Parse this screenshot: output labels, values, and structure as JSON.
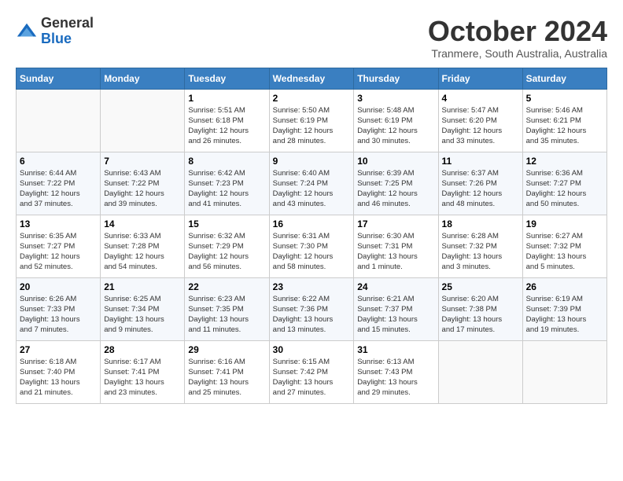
{
  "header": {
    "logo_general": "General",
    "logo_blue": "Blue",
    "month_title": "October 2024",
    "location": "Tranmere, South Australia, Australia"
  },
  "calendar": {
    "days_of_week": [
      "Sunday",
      "Monday",
      "Tuesday",
      "Wednesday",
      "Thursday",
      "Friday",
      "Saturday"
    ],
    "weeks": [
      [
        {
          "day": "",
          "info": ""
        },
        {
          "day": "",
          "info": ""
        },
        {
          "day": "1",
          "info": "Sunrise: 5:51 AM\nSunset: 6:18 PM\nDaylight: 12 hours\nand 26 minutes."
        },
        {
          "day": "2",
          "info": "Sunrise: 5:50 AM\nSunset: 6:19 PM\nDaylight: 12 hours\nand 28 minutes."
        },
        {
          "day": "3",
          "info": "Sunrise: 5:48 AM\nSunset: 6:19 PM\nDaylight: 12 hours\nand 30 minutes."
        },
        {
          "day": "4",
          "info": "Sunrise: 5:47 AM\nSunset: 6:20 PM\nDaylight: 12 hours\nand 33 minutes."
        },
        {
          "day": "5",
          "info": "Sunrise: 5:46 AM\nSunset: 6:21 PM\nDaylight: 12 hours\nand 35 minutes."
        }
      ],
      [
        {
          "day": "6",
          "info": "Sunrise: 6:44 AM\nSunset: 7:22 PM\nDaylight: 12 hours\nand 37 minutes."
        },
        {
          "day": "7",
          "info": "Sunrise: 6:43 AM\nSunset: 7:22 PM\nDaylight: 12 hours\nand 39 minutes."
        },
        {
          "day": "8",
          "info": "Sunrise: 6:42 AM\nSunset: 7:23 PM\nDaylight: 12 hours\nand 41 minutes."
        },
        {
          "day": "9",
          "info": "Sunrise: 6:40 AM\nSunset: 7:24 PM\nDaylight: 12 hours\nand 43 minutes."
        },
        {
          "day": "10",
          "info": "Sunrise: 6:39 AM\nSunset: 7:25 PM\nDaylight: 12 hours\nand 46 minutes."
        },
        {
          "day": "11",
          "info": "Sunrise: 6:37 AM\nSunset: 7:26 PM\nDaylight: 12 hours\nand 48 minutes."
        },
        {
          "day": "12",
          "info": "Sunrise: 6:36 AM\nSunset: 7:27 PM\nDaylight: 12 hours\nand 50 minutes."
        }
      ],
      [
        {
          "day": "13",
          "info": "Sunrise: 6:35 AM\nSunset: 7:27 PM\nDaylight: 12 hours\nand 52 minutes."
        },
        {
          "day": "14",
          "info": "Sunrise: 6:33 AM\nSunset: 7:28 PM\nDaylight: 12 hours\nand 54 minutes."
        },
        {
          "day": "15",
          "info": "Sunrise: 6:32 AM\nSunset: 7:29 PM\nDaylight: 12 hours\nand 56 minutes."
        },
        {
          "day": "16",
          "info": "Sunrise: 6:31 AM\nSunset: 7:30 PM\nDaylight: 12 hours\nand 58 minutes."
        },
        {
          "day": "17",
          "info": "Sunrise: 6:30 AM\nSunset: 7:31 PM\nDaylight: 13 hours\nand 1 minute."
        },
        {
          "day": "18",
          "info": "Sunrise: 6:28 AM\nSunset: 7:32 PM\nDaylight: 13 hours\nand 3 minutes."
        },
        {
          "day": "19",
          "info": "Sunrise: 6:27 AM\nSunset: 7:32 PM\nDaylight: 13 hours\nand 5 minutes."
        }
      ],
      [
        {
          "day": "20",
          "info": "Sunrise: 6:26 AM\nSunset: 7:33 PM\nDaylight: 13 hours\nand 7 minutes."
        },
        {
          "day": "21",
          "info": "Sunrise: 6:25 AM\nSunset: 7:34 PM\nDaylight: 13 hours\nand 9 minutes."
        },
        {
          "day": "22",
          "info": "Sunrise: 6:23 AM\nSunset: 7:35 PM\nDaylight: 13 hours\nand 11 minutes."
        },
        {
          "day": "23",
          "info": "Sunrise: 6:22 AM\nSunset: 7:36 PM\nDaylight: 13 hours\nand 13 minutes."
        },
        {
          "day": "24",
          "info": "Sunrise: 6:21 AM\nSunset: 7:37 PM\nDaylight: 13 hours\nand 15 minutes."
        },
        {
          "day": "25",
          "info": "Sunrise: 6:20 AM\nSunset: 7:38 PM\nDaylight: 13 hours\nand 17 minutes."
        },
        {
          "day": "26",
          "info": "Sunrise: 6:19 AM\nSunset: 7:39 PM\nDaylight: 13 hours\nand 19 minutes."
        }
      ],
      [
        {
          "day": "27",
          "info": "Sunrise: 6:18 AM\nSunset: 7:40 PM\nDaylight: 13 hours\nand 21 minutes."
        },
        {
          "day": "28",
          "info": "Sunrise: 6:17 AM\nSunset: 7:41 PM\nDaylight: 13 hours\nand 23 minutes."
        },
        {
          "day": "29",
          "info": "Sunrise: 6:16 AM\nSunset: 7:41 PM\nDaylight: 13 hours\nand 25 minutes."
        },
        {
          "day": "30",
          "info": "Sunrise: 6:15 AM\nSunset: 7:42 PM\nDaylight: 13 hours\nand 27 minutes."
        },
        {
          "day": "31",
          "info": "Sunrise: 6:13 AM\nSunset: 7:43 PM\nDaylight: 13 hours\nand 29 minutes."
        },
        {
          "day": "",
          "info": ""
        },
        {
          "day": "",
          "info": ""
        }
      ]
    ]
  }
}
